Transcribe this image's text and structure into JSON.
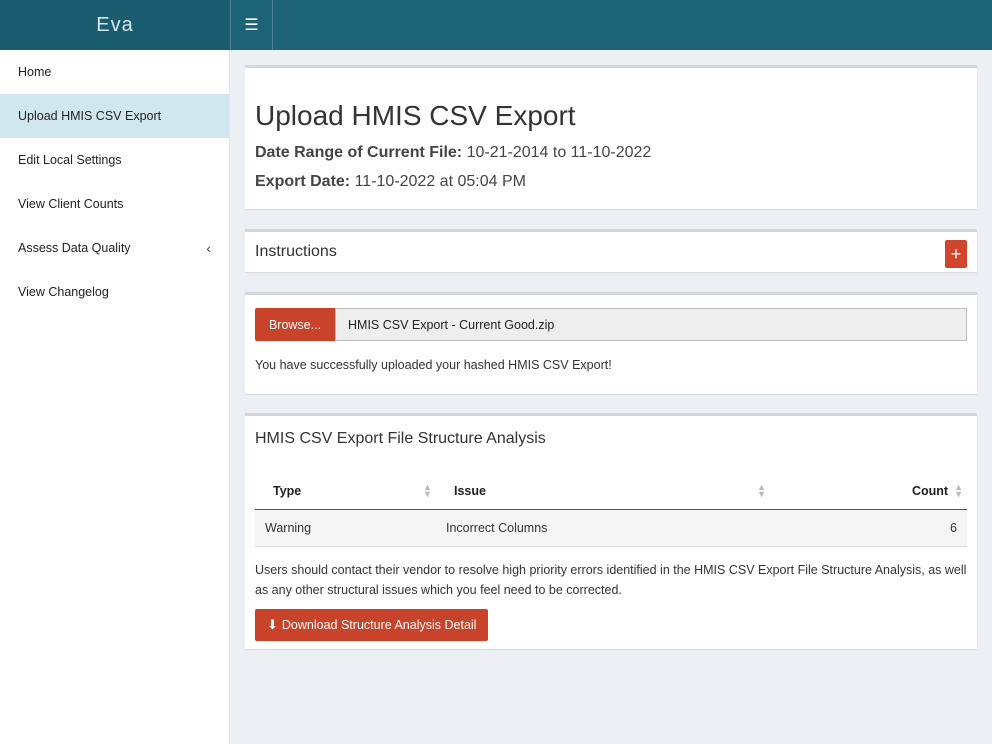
{
  "app": {
    "brand": "Eva",
    "menu_toggle_icon": "hamburger-icon"
  },
  "sidebar": {
    "items": [
      {
        "label": "Home"
      },
      {
        "label": "Upload HMIS CSV Export",
        "active": true
      },
      {
        "label": "Edit Local Settings"
      },
      {
        "label": "View Client Counts"
      },
      {
        "label": "Assess Data Quality",
        "icon": "chevron-left-icon"
      },
      {
        "label": "View Changelog"
      }
    ]
  },
  "header_box": {
    "title": "Upload HMIS CSV Export",
    "date_range_label": "Date Range of Current File:",
    "date_range_value": "10-21-2014 to 11-10-2022",
    "export_date_label": "Export Date:",
    "export_date_value": "11-10-2022 at 05:04 PM"
  },
  "instructions": {
    "title": "Instructions",
    "expand_label": "+"
  },
  "upload": {
    "browse_label": "Browse...",
    "file_name": "HMIS CSV Export - Current Good.zip",
    "success_message": "You have successfully uploaded your hashed HMIS CSV Export!"
  },
  "analysis": {
    "title": "HMIS CSV Export File Structure Analysis",
    "columns": [
      "Type",
      "Issue",
      "Count"
    ],
    "rows": [
      {
        "type": "Warning",
        "issue": "Incorrect Columns",
        "count": "6"
      }
    ],
    "note": "Users should contact their vendor to resolve high priority errors identified in the HMIS CSV Export File Structure Analysis, as well as any other structural issues which you feel need to be corrected.",
    "download_label": "Download Structure Analysis Detail"
  },
  "colors": {
    "header": "#1d6378",
    "brand_bg": "#1a5c6f",
    "accent_button": "#c9432a",
    "active_nav": "#d1e7ef"
  }
}
